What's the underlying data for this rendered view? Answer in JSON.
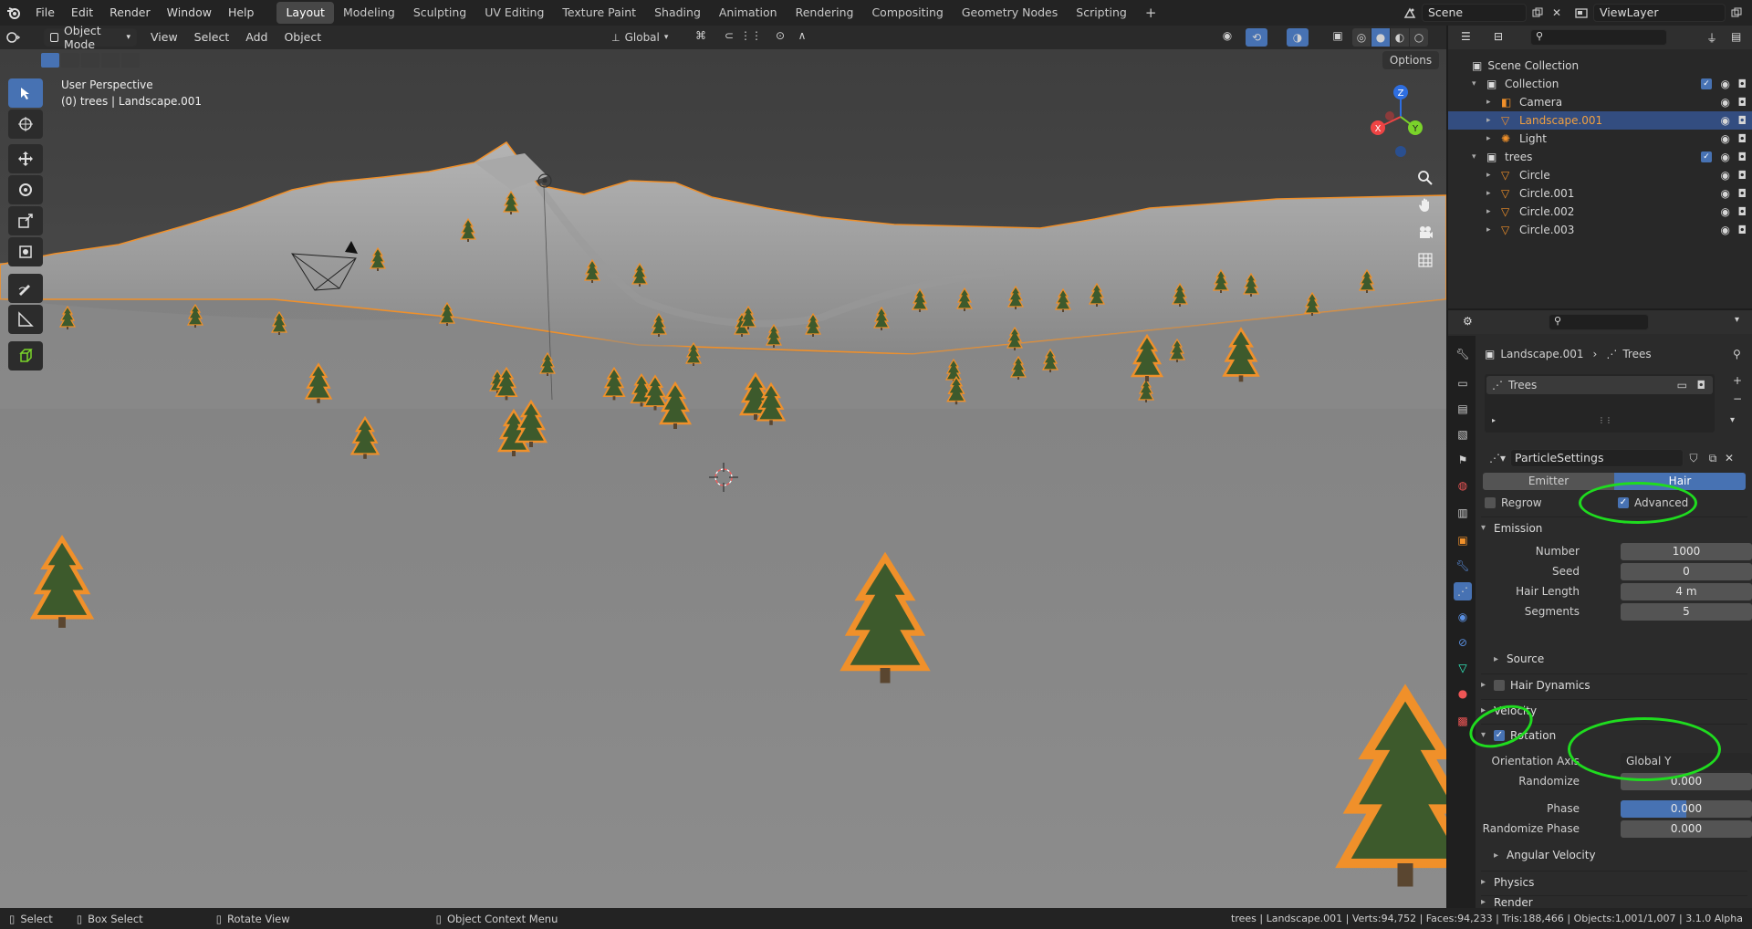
{
  "topbar": {
    "menus": [
      "File",
      "Edit",
      "Render",
      "Window",
      "Help"
    ],
    "workspaces": [
      "Layout",
      "Modeling",
      "Sculpting",
      "UV Editing",
      "Texture Paint",
      "Shading",
      "Animation",
      "Rendering",
      "Compositing",
      "Geometry Nodes",
      "Scripting"
    ],
    "active_workspace": "Layout",
    "add_tab": "+",
    "scene": "Scene",
    "view_layer": "ViewLayer"
  },
  "viewport_header": {
    "mode": "Object Mode",
    "menus": [
      "View",
      "Select",
      "Add",
      "Object"
    ],
    "orientation": "Global",
    "options": "Options"
  },
  "viewport": {
    "perspective": "User Perspective",
    "context": "(0) trees | Landscape.001",
    "gizmo_axes": [
      "X",
      "Y",
      "Z"
    ]
  },
  "outliner": {
    "root": "Scene Collection",
    "items": [
      {
        "label": "Collection",
        "level": 1,
        "type": "collection"
      },
      {
        "label": "Camera",
        "level": 2,
        "type": "camera"
      },
      {
        "label": "Landscape.001",
        "level": 2,
        "type": "mesh",
        "selected": true
      },
      {
        "label": "Light",
        "level": 2,
        "type": "light"
      },
      {
        "label": "trees",
        "level": 1,
        "type": "collection"
      },
      {
        "label": "Circle",
        "level": 2,
        "type": "mesh"
      },
      {
        "label": "Circle.001",
        "level": 2,
        "type": "mesh"
      },
      {
        "label": "Circle.002",
        "level": 2,
        "type": "mesh"
      },
      {
        "label": "Circle.003",
        "level": 2,
        "type": "mesh"
      }
    ]
  },
  "properties": {
    "breadcrumb_object": "Landscape.001",
    "breadcrumb_system": "Trees",
    "particle_system": "Trees",
    "settings_name": "ParticleSettings",
    "type_tabs": [
      "Emitter",
      "Hair"
    ],
    "active_type": "Hair",
    "regrow_label": "Regrow",
    "advanced_label": "Advanced",
    "emission": {
      "title": "Emission",
      "fields": [
        {
          "label": "Number",
          "value": "1000"
        },
        {
          "label": "Seed",
          "value": "0"
        },
        {
          "label": "Hair Length",
          "value": "4 m"
        },
        {
          "label": "Segments",
          "value": "5"
        }
      ],
      "source": "Source"
    },
    "hair_dynamics": "Hair Dynamics",
    "velocity": "Velocity",
    "rotation": {
      "title": "Rotation",
      "orientation_label": "Orientation Axis",
      "orientation_value": "Global Y",
      "randomize_label": "Randomize",
      "randomize_value": "0.000",
      "phase_label": "Phase",
      "phase_value": "0.000",
      "randomize_phase_label": "Randomize Phase",
      "randomize_phase_value": "0.000",
      "angular_velocity": "Angular Velocity"
    },
    "physics": "Physics",
    "render": "Render"
  },
  "statusbar": {
    "select": "Select",
    "box_select": "Box Select",
    "rotate_view": "Rotate View",
    "context_menu": "Object Context Menu",
    "stats": "trees | Landscape.001 | Verts:94,752 | Faces:94,233 | Tris:188,466 | Objects:1,001/1,007 | 3.1.0 Alpha"
  },
  "colors": {
    "accent": "#4772b3",
    "selection_outline": "#f0902a",
    "annotation": "#1fdc1f",
    "tree": "#3d5a2c"
  }
}
